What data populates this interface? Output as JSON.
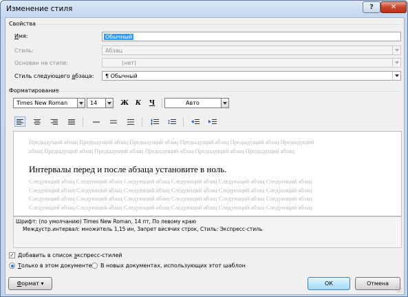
{
  "window": {
    "title": "Изменение стиля",
    "help": "?",
    "close": "✕"
  },
  "properties": {
    "section": "Свойства",
    "name_label": "Имя:",
    "name_value": "Обычный",
    "style_label": "Стиль:",
    "style_value": "Абзац",
    "based_label": "Основан на стиле:",
    "based_value": "(нет)",
    "next_label": "Стиль следующего абзаца:",
    "next_value": "¶ Обычный"
  },
  "formatting": {
    "section": "Форматирование",
    "font": "Times New Roman",
    "size": "14",
    "bold": "Ж",
    "italic": "К",
    "underline": "Ч",
    "color": "Авто"
  },
  "preview": {
    "prev_line1": "Предыдущий абзац Предыдущий абзац Предыдущий абзац Предыдущий абзац Предыдущий абзац Предыдущий",
    "prev_line2": "абзац Предыдущий абзац Предыдущий абзац Предыдущий абзац Предыдущий абзац Предыдущий абзац",
    "main": "Интервалы перед и после абзаца установите в ноль.",
    "next_lines": [
      "Следующий абзац Следующий абзац Следующий абзац Следующий абзац Следующий абзац Следующий абзац",
      "Следующий абзац Следующий абзац Следующий абзац Следующий абзац Следующий абзац Следующий абзац",
      "Следующий абзац Следующий абзац Следующий абзац Следующий абзац Следующий абзац Следующий абзац",
      "Следующий абзац Следующий абзац Следующий абзац Следующий абзац Следующий абзац Следующий абзац"
    ]
  },
  "description": {
    "line1": "Шрифт: (по умолчанию) Times New Roman, 14 пт, По левому краю",
    "line2": "Междустр.интервал:  множитель 1,15 ин, Запрет висячих строк, Стиль: Экспресс-стиль"
  },
  "options": {
    "add_to_quick": "Добавить в список экспресс-стилей",
    "only_this_doc": "Только в этом документе",
    "new_docs": "В новых документах, использующих этот шаблон",
    "checkmark": "✓"
  },
  "buttons": {
    "format": "Формат ▾",
    "ok": "ОК",
    "cancel": "Отмена"
  }
}
